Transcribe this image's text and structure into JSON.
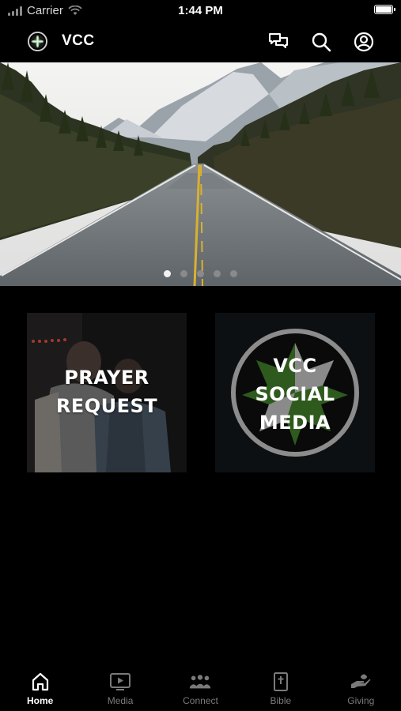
{
  "status_bar": {
    "carrier": "Carrier",
    "time": "1:44 PM"
  },
  "header": {
    "title": "VCC",
    "icons": [
      "chat-icon",
      "search-icon",
      "account-icon"
    ]
  },
  "hero": {
    "slide_count": 5,
    "active_index": 0
  },
  "tiles": [
    {
      "id": "prayer-request",
      "lines": [
        "PRAYER",
        "REQUEST"
      ]
    },
    {
      "id": "vcc-social-media",
      "lines": [
        "VCC",
        "SOCIAL",
        "MEDIA"
      ]
    }
  ],
  "bottom_nav": {
    "items": [
      {
        "label": "Home",
        "icon": "home-icon",
        "active": true
      },
      {
        "label": "Media",
        "icon": "tv-play-icon",
        "active": false
      },
      {
        "label": "Connect",
        "icon": "group-icon",
        "active": false
      },
      {
        "label": "Bible",
        "icon": "bible-icon",
        "active": false
      },
      {
        "label": "Giving",
        "icon": "giving-hand-icon",
        "active": false
      }
    ]
  },
  "colors": {
    "background": "#000000",
    "active": "#ffffff",
    "inactive": "#7a7a7a",
    "logo_green": "#2e7d32"
  }
}
